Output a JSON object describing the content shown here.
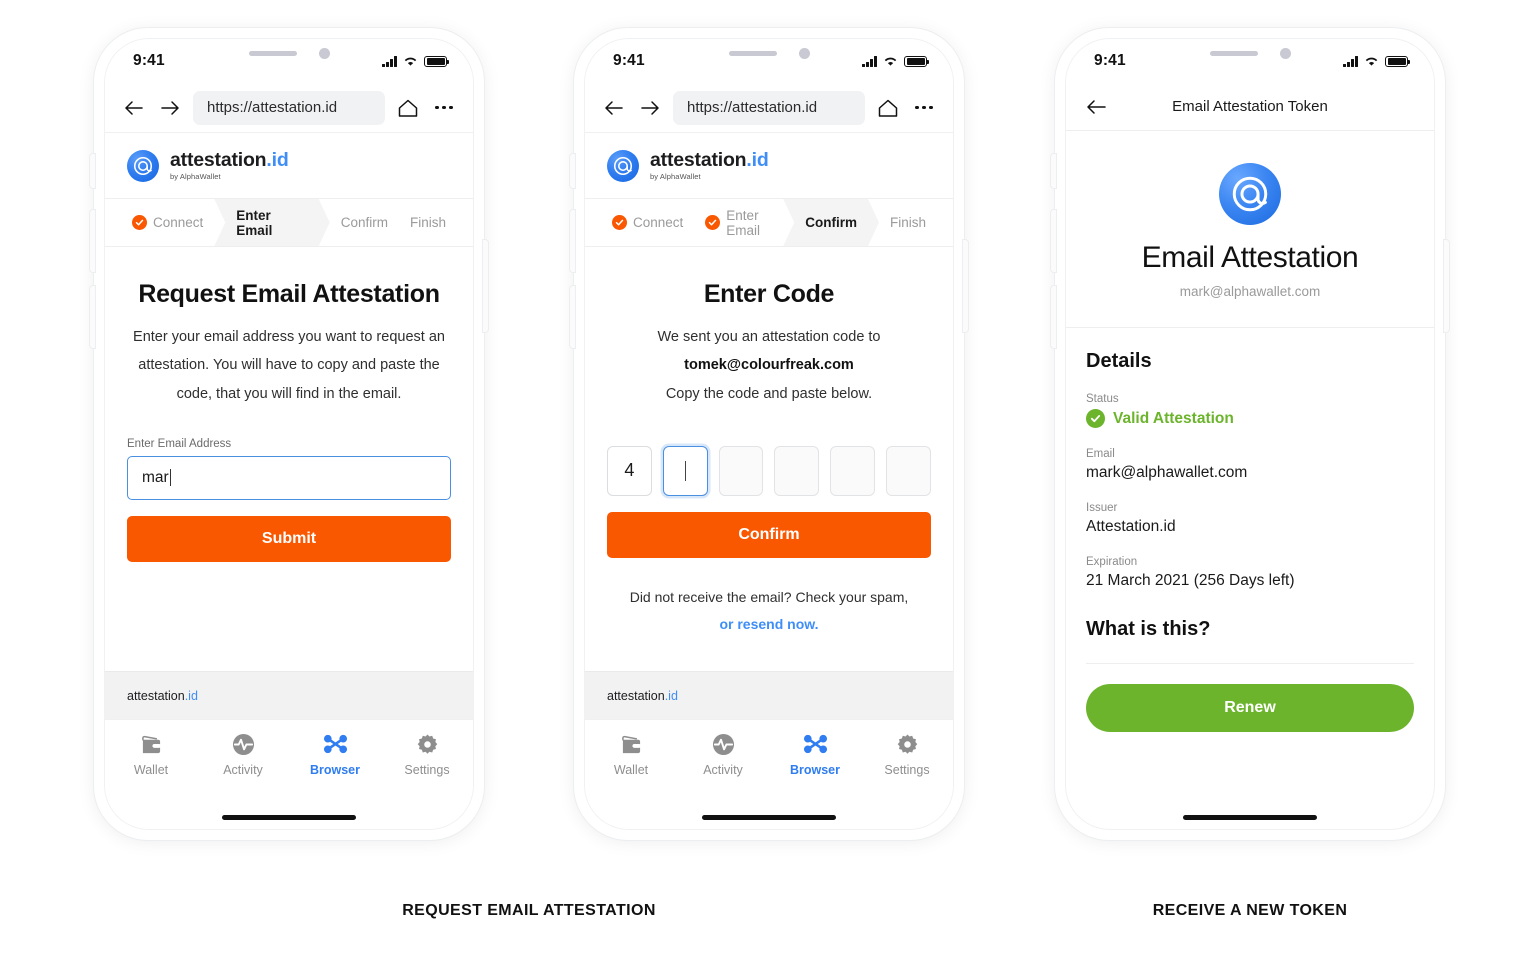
{
  "colors": {
    "orange": "#f95700",
    "green": "#6cb42c",
    "blue": "#3f8ef7",
    "focus_blue": "#4a90e2"
  },
  "status_bar": {
    "time": "9:41"
  },
  "browser": {
    "url": "https://attestation.id",
    "back_icon": "arrow-left-icon",
    "forward_icon": "arrow-right-icon",
    "home_icon": "home-icon",
    "more_icon": "more-dots-icon"
  },
  "site_header": {
    "logo_icon": "at-sign-logo-icon",
    "name": "attestation",
    "tld": ".id",
    "subtitle": "by AlphaWallet"
  },
  "stepper": {
    "screen1": [
      {
        "label": "Connect",
        "state": "done"
      },
      {
        "label": "Enter Email",
        "state": "active"
      },
      {
        "label": "Confirm",
        "state": "todo"
      },
      {
        "label": "Finish",
        "state": "todo"
      }
    ],
    "screen2": [
      {
        "label": "Connect",
        "state": "done"
      },
      {
        "label": "Enter Email",
        "state": "done"
      },
      {
        "label": "Confirm",
        "state": "active"
      },
      {
        "label": "Finish",
        "state": "todo"
      }
    ]
  },
  "screen1": {
    "title": "Request Email Attestation",
    "description": "Enter your email address you want to request an attestation. You will have to copy and paste the code, that you will find in the email.",
    "field_label": "Enter Email Address",
    "field_value": "mar",
    "submit_label": "Submit"
  },
  "screen2": {
    "title": "Enter Code",
    "desc_line1": "We sent you an attestation code to",
    "desc_email": "tomek@colourfreak.com",
    "desc_line2": "Copy the code and paste below.",
    "code_digits": [
      "4",
      "",
      "",
      "",
      "",
      ""
    ],
    "confirm_label": "Confirm",
    "help_text": "Did not receive the email? Check your spam,",
    "help_link": "or resend now."
  },
  "site_footer": {
    "name": "attestation",
    "tld": ".id"
  },
  "tabbar": {
    "items": [
      {
        "label": "Wallet",
        "icon": "wallet-icon",
        "active": false
      },
      {
        "label": "Activity",
        "icon": "activity-pulse-icon",
        "active": false
      },
      {
        "label": "Browser",
        "icon": "browser-nodes-icon",
        "active": true
      },
      {
        "label": "Settings",
        "icon": "gear-icon",
        "active": false
      }
    ]
  },
  "screen3": {
    "appbar_title": "Email Attestation Token",
    "back_icon": "arrow-left-icon",
    "token_logo_icon": "at-sign-logo-icon",
    "token_name": "Email Attestation",
    "token_email": "mark@alphawallet.com",
    "details_heading": "Details",
    "rows": [
      {
        "label": "Status",
        "value": "Valid Attestation",
        "icon": "check-circle-icon"
      },
      {
        "label": "Email",
        "value": "mark@alphawallet.com"
      },
      {
        "label": "Issuer",
        "value": "Attestation.id"
      },
      {
        "label": "Expiration",
        "value": "21 March 2021 (256 Days left)"
      }
    ],
    "what_is_this": "What is this?",
    "renew_label": "Renew"
  },
  "captions": {
    "left": "REQUEST EMAIL ATTESTATION",
    "right": "RECEIVE A NEW TOKEN"
  }
}
